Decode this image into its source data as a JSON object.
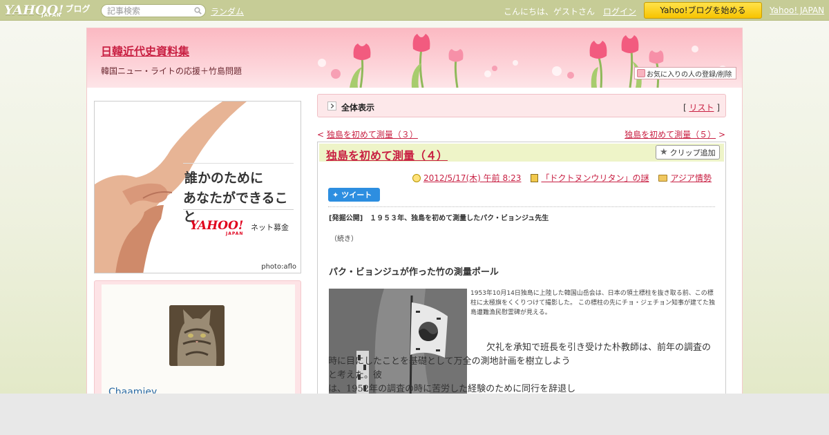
{
  "topbar": {
    "logo_yahoo": "YAHOO!",
    "logo_japan": "JAPAN",
    "logo_blog": "ブログ",
    "search_placeholder": "記事検索",
    "random_label": "ランダム",
    "greeting": "こんにちは、ゲストさん",
    "login_label": "ログイン",
    "start_blog_label": "Yahoo!ブログを始める",
    "yahoo_japan_label": "Yahoo! JAPAN"
  },
  "header": {
    "title": "日韓近代史資料集",
    "description": "韓国ニュー・ライトの応援＋竹島問題",
    "fav_label": "お気に入りの人の登録/削除"
  },
  "ad": {
    "line1": "誰かのために",
    "line2": "あなたができること",
    "logo_yahoo": "YAHOO!",
    "logo_japan": "JAPAN",
    "service": "ネット募金",
    "credit": "photo:aflo"
  },
  "profile": {
    "username": "Chaamiey"
  },
  "nav": {
    "all_view_label": "全体表示",
    "list_open": "[",
    "list_label": "リスト",
    "list_close": "]",
    "prev_arrow": "<",
    "prev_title": "独島を初めて測量（３）",
    "next_title": "独島を初めて測量（５）",
    "next_arrow": ">"
  },
  "article": {
    "title": "独島を初めて測量（４）",
    "clip_label": "クリップ追加",
    "date": "2012/5/17(木) 午前 8:23",
    "book": "「ドクトヌンウリタン」の謎",
    "category": "アジア情勢",
    "tweet_label": "ツイート",
    "kicker": "[発掘公開]　１９５３年、独島を初めて測量したパク・ビョンジュ先生",
    "continued": "（続き）",
    "subheading": "パク・ビョンジュが作った竹の測量ポール",
    "caption": "1953年10月14日独島に上陸した韓国山岳会は、日本の領土標柱を抜き取る前、この標柱に太極旗をくくりつけて撮影した。 この標柱の先にチョ・ジェチョン知事が建てた独島遭難漁民慰霊碑が見える。",
    "body_line1": "欠礼を承知で班長を引き受けた朴教師は、前年の調査の",
    "body_line2": "時に目にしたことを基礎として万全の測地計画を樹立しよう",
    "body_line3": "と考えた。彼",
    "body_line4": "は、1952年の調査の時に苦労した経験のために同行を辞退し"
  },
  "colors": {
    "topbar": "#c6cc96",
    "accent_link": "#c81f42",
    "header_pink": "#fbb9c2",
    "article_head": "#eef4c8",
    "tweet_blue": "#2d8ee0",
    "start_button": "#f7c400"
  },
  "icons": [
    "search-icon",
    "fav-heart-icon",
    "arrow-right-icon",
    "star-icon",
    "clock-icon",
    "book-icon",
    "folder-icon",
    "bird-icon"
  ]
}
